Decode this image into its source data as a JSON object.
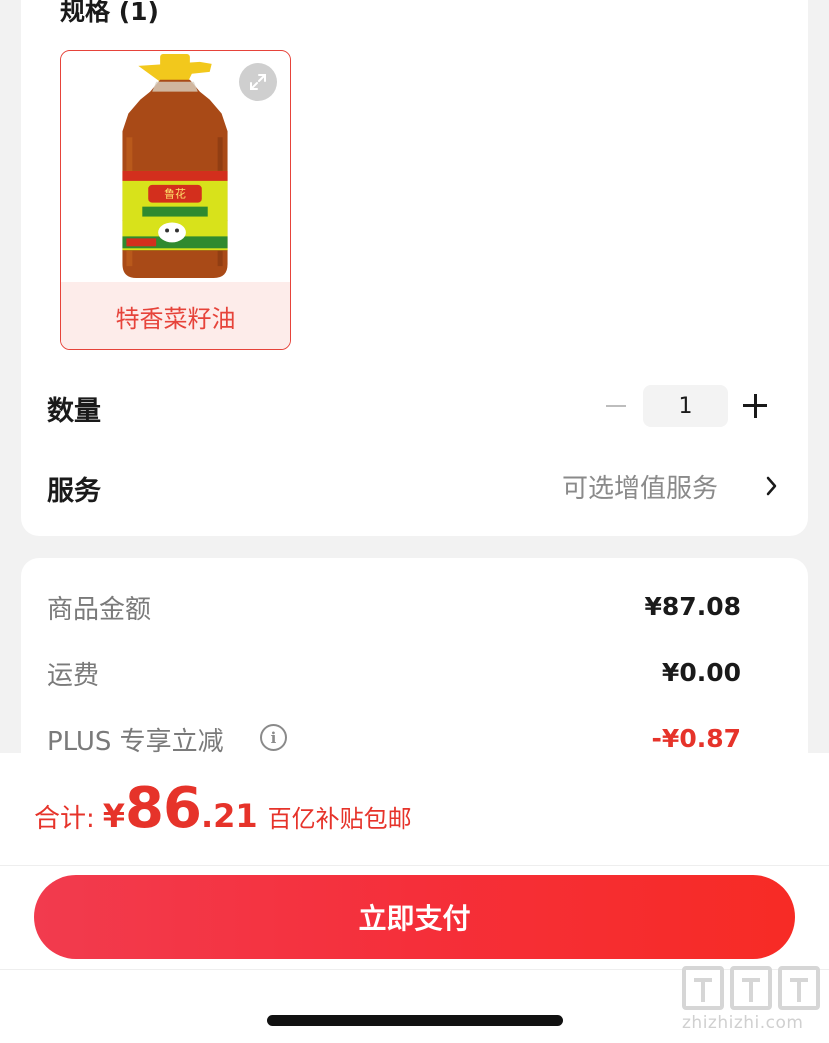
{
  "spec": {
    "title": "规格 (1)",
    "option_label": "特香菜籽油",
    "option_selected": true,
    "product_label_text": "鲁花"
  },
  "quantity": {
    "label": "数量",
    "value": "1"
  },
  "service": {
    "label": "服务",
    "value": "可选增值服务"
  },
  "fees": {
    "goods_label": "商品金额",
    "goods_value": "¥87.08",
    "shipping_label": "运费",
    "shipping_value": "¥0.00",
    "plus_label": "PLUS 专享立减",
    "plus_value": "-¥0.87"
  },
  "total": {
    "label": "合计:",
    "currency": "¥",
    "integer": "86",
    "decimal": ".21",
    "note": "百亿补贴包邮"
  },
  "pay_button": {
    "label": "立即支付"
  },
  "watermark": {
    "text": "zhizhizhi.com"
  },
  "colors": {
    "accent": "#e6332a",
    "button_start": "#f23b4e",
    "button_end": "#f72b25"
  }
}
